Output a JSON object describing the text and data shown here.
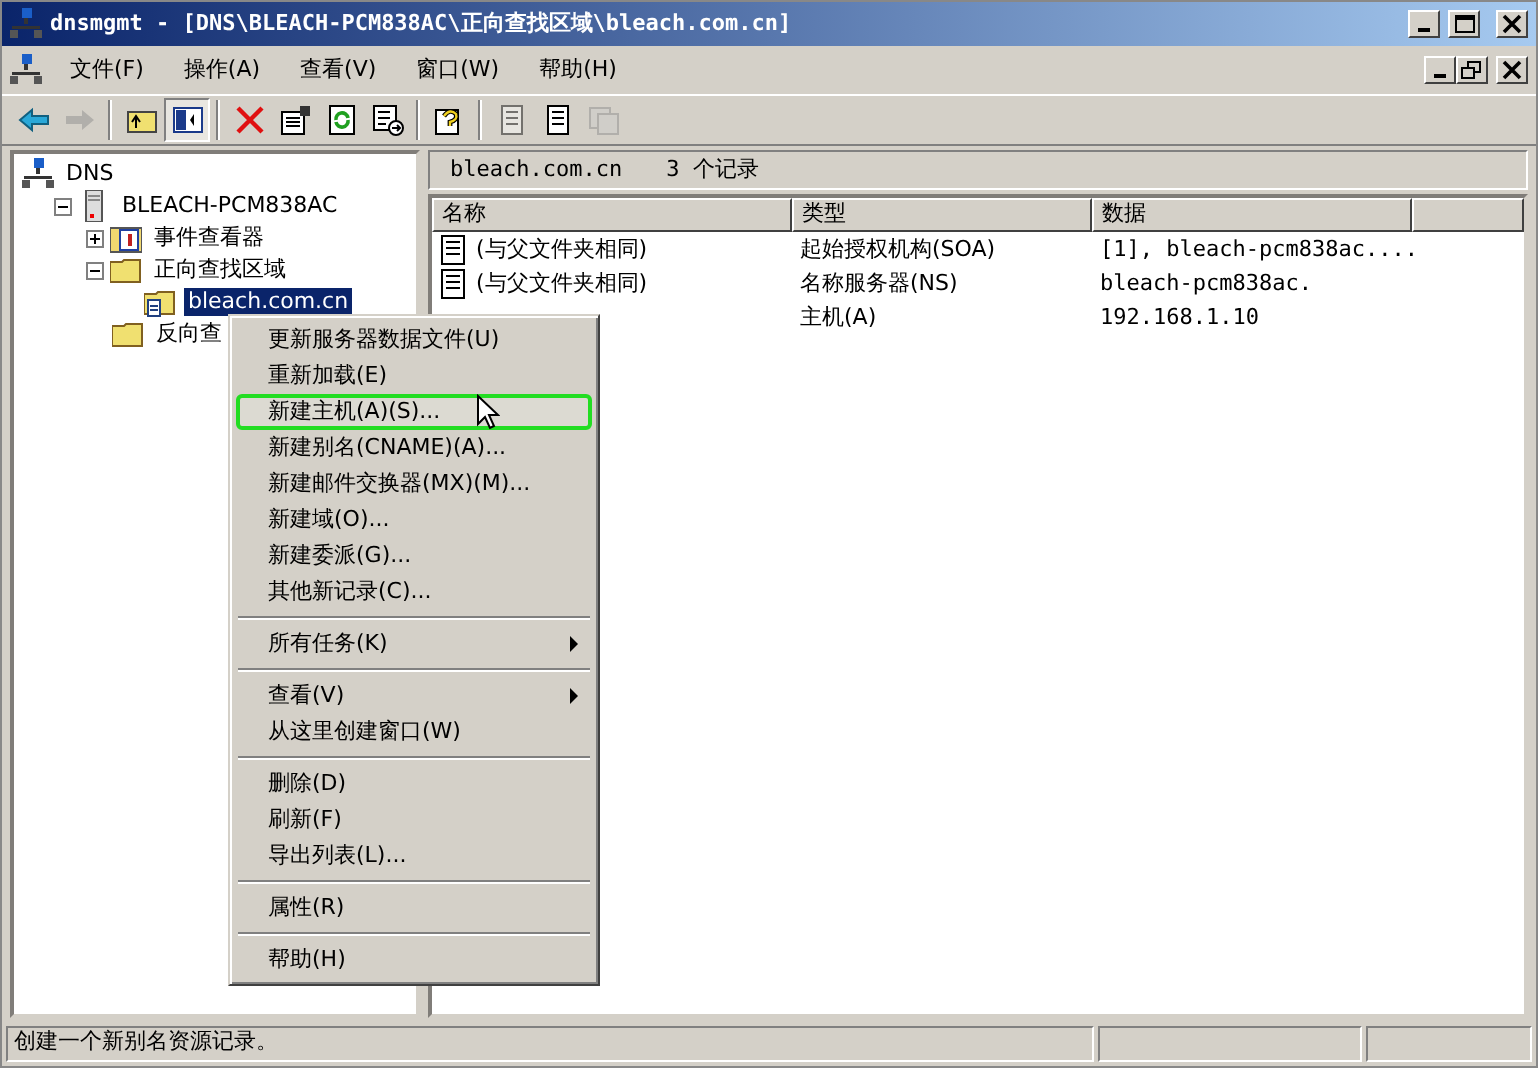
{
  "window": {
    "title": "dnsmgmt - [DNS\\BLEACH-PCM838AC\\正向查找区域\\bleach.com.cn]"
  },
  "menu": [
    "文件(F)",
    "操作(A)",
    "查看(V)",
    "窗口(W)",
    "帮助(H)"
  ],
  "toolbar": [
    {
      "kind": "back",
      "disabled": false,
      "pressed": false
    },
    {
      "kind": "forward",
      "disabled": true,
      "pressed": false
    },
    {
      "kind": "sep"
    },
    {
      "kind": "up",
      "disabled": false,
      "pressed": false
    },
    {
      "kind": "tree",
      "disabled": false,
      "pressed": true
    },
    {
      "kind": "sep"
    },
    {
      "kind": "delete",
      "disabled": false,
      "pressed": false
    },
    {
      "kind": "properties",
      "disabled": false,
      "pressed": false
    },
    {
      "kind": "refresh",
      "disabled": false,
      "pressed": false
    },
    {
      "kind": "export",
      "disabled": false,
      "pressed": false
    },
    {
      "kind": "sep"
    },
    {
      "kind": "help",
      "disabled": false,
      "pressed": false
    },
    {
      "kind": "sep"
    },
    {
      "kind": "record",
      "disabled": true,
      "pressed": false
    },
    {
      "kind": "record",
      "disabled": false,
      "pressed": false
    },
    {
      "kind": "records",
      "disabled": true,
      "pressed": false
    }
  ],
  "tree": [
    {
      "label": "DNS",
      "kind": "dns",
      "selected": false,
      "children": [
        {
          "label": "BLEACH-PCM838AC",
          "kind": "server",
          "expanded": true,
          "selected": false,
          "children": [
            {
              "label": "事件查看器",
              "kind": "events",
              "expanded": false,
              "selected": false
            },
            {
              "label": "正向查找区域",
              "kind": "folder",
              "expanded": true,
              "selected": false,
              "children": [
                {
                  "label": "bleach.com.cn",
                  "kind": "zone",
                  "selected": true
                }
              ]
            },
            {
              "label": "反向查",
              "kind": "folder",
              "selected": false
            }
          ]
        }
      ]
    }
  ],
  "pane": {
    "title": "bleach.com.cn",
    "count": "3 个记录"
  },
  "table": {
    "columns": [
      "名称",
      "类型",
      "数据"
    ],
    "rows": [
      {
        "name": "(与父文件夹相同)",
        "type": "起始授权机构(SOA)",
        "data": "[1], bleach-pcm838ac...."
      },
      {
        "name": "(与父文件夹相同)",
        "type": "名称服务器(NS)",
        "data": "bleach-pcm838ac."
      },
      {
        "type": "主机(A)",
        "data": "192.168.1.10"
      }
    ]
  },
  "context_menu": [
    {
      "kind": "item",
      "label": "更新服务器数据文件(U)",
      "highlighted": false
    },
    {
      "kind": "item",
      "label": "重新加载(E)",
      "highlighted": false
    },
    {
      "kind": "item",
      "label": "新建主机(A)(S)...",
      "highlighted": true
    },
    {
      "kind": "item",
      "label": "新建别名(CNAME)(A)...",
      "highlighted": false
    },
    {
      "kind": "item",
      "label": "新建邮件交换器(MX)(M)...",
      "highlighted": false
    },
    {
      "kind": "item",
      "label": "新建域(O)...",
      "highlighted": false
    },
    {
      "kind": "item",
      "label": "新建委派(G)...",
      "highlighted": false
    },
    {
      "kind": "item",
      "label": "其他新记录(C)...",
      "highlighted": false
    },
    {
      "kind": "separator"
    },
    {
      "kind": "submenu",
      "label": "所有任务(K)",
      "highlighted": false
    },
    {
      "kind": "separator"
    },
    {
      "kind": "submenu",
      "label": "查看(V)",
      "highlighted": false
    },
    {
      "kind": "item",
      "label": "从这里创建窗口(W)",
      "highlighted": false
    },
    {
      "kind": "separator"
    },
    {
      "kind": "item",
      "label": "删除(D)",
      "highlighted": false
    },
    {
      "kind": "item",
      "label": "刷新(F)",
      "highlighted": false
    },
    {
      "kind": "item",
      "label": "导出列表(L)...",
      "highlighted": false
    },
    {
      "kind": "separator"
    },
    {
      "kind": "item",
      "label": "属性(R)",
      "highlighted": false
    },
    {
      "kind": "separator"
    },
    {
      "kind": "item",
      "label": "帮助(H)",
      "highlighted": false
    }
  ],
  "status_bar": {
    "text": "创建一个新别名资源记录。"
  }
}
